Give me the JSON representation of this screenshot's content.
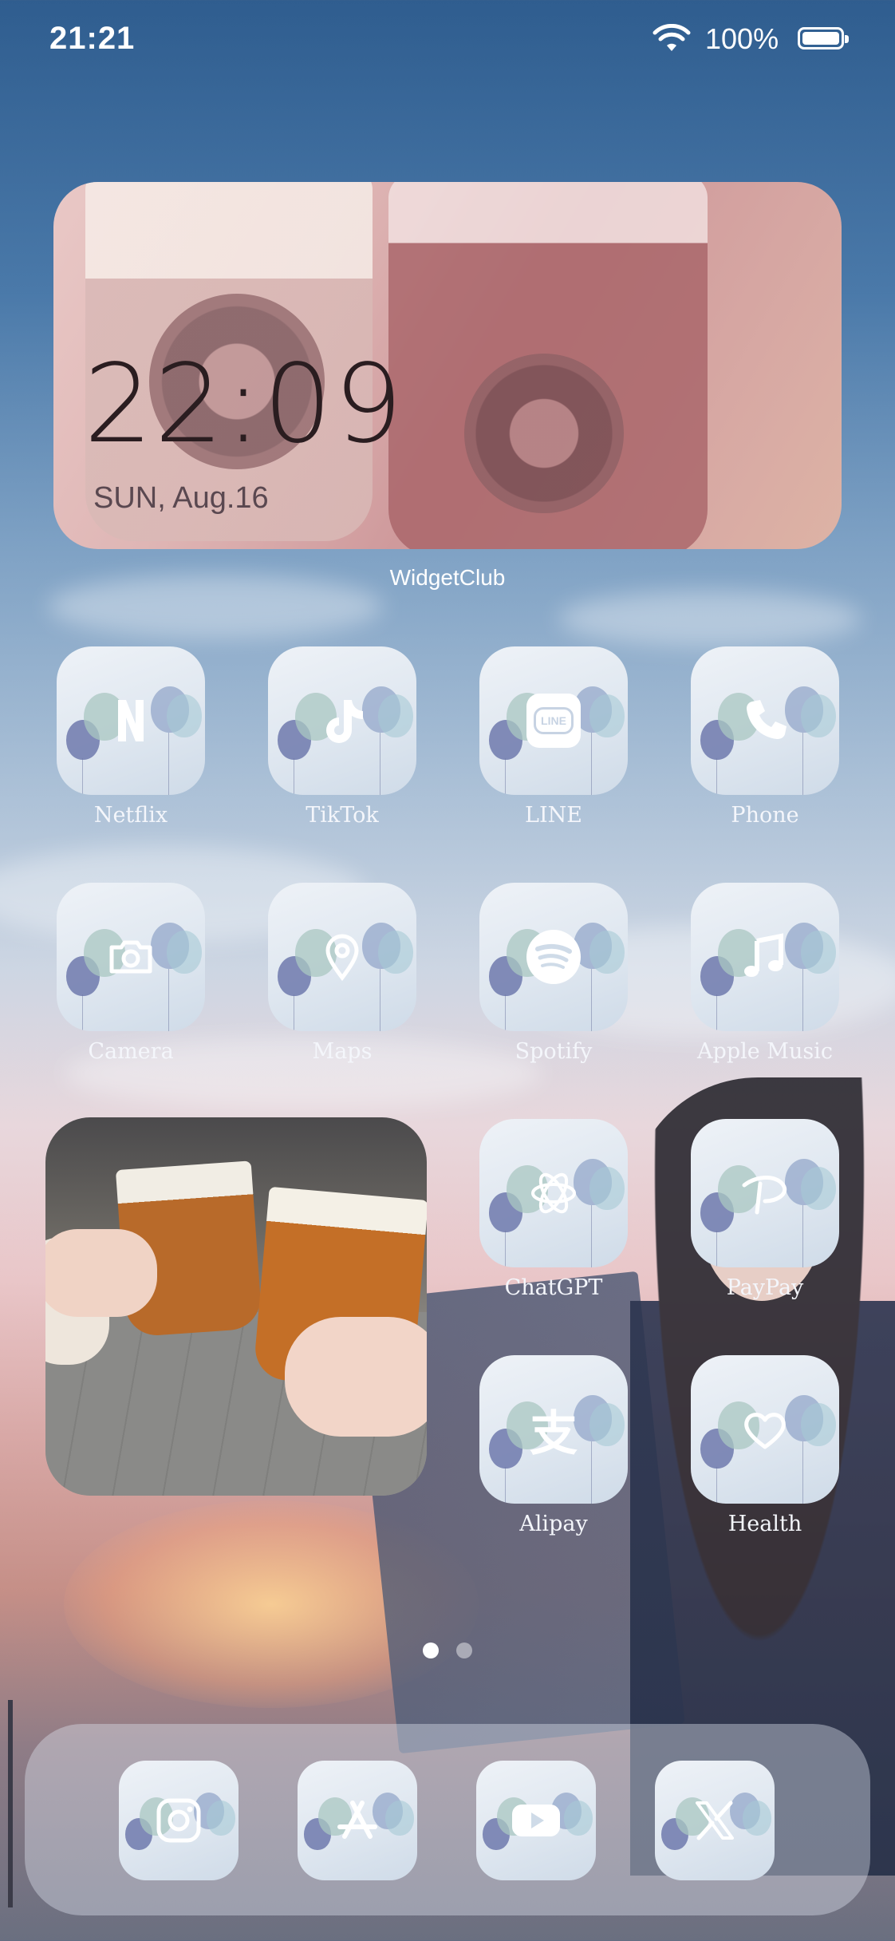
{
  "status_bar": {
    "time": "21:21",
    "battery_percent": "100%"
  },
  "clock_widget": {
    "time": "22:09",
    "date": "SUN, Aug.16",
    "label": "WidgetClub"
  },
  "apps": [
    {
      "label": "Netflix",
      "icon": "netflix-icon"
    },
    {
      "label": "TikTok",
      "icon": "tiktok-icon"
    },
    {
      "label": "LINE",
      "icon": "line-icon",
      "glyph_text": "LINE"
    },
    {
      "label": "Phone",
      "icon": "phone-icon"
    },
    {
      "label": "Camera",
      "icon": "camera-icon"
    },
    {
      "label": "Maps",
      "icon": "map-pin-icon"
    },
    {
      "label": "Spotify",
      "icon": "spotify-icon"
    },
    {
      "label": "Apple Music",
      "icon": "music-note-icon"
    },
    {
      "label": "ChatGPT",
      "icon": "chatgpt-icon"
    },
    {
      "label": "PayPay",
      "icon": "paypay-icon"
    },
    {
      "label": "Alipay",
      "icon": "alipay-icon",
      "glyph_text": "支"
    },
    {
      "label": "Health",
      "icon": "heart-icon"
    }
  ],
  "dock": [
    {
      "icon": "instagram-icon"
    },
    {
      "icon": "app-store-icon"
    },
    {
      "icon": "youtube-icon"
    },
    {
      "icon": "x-icon"
    }
  ],
  "page_indicator": {
    "current": 1,
    "total": 2
  },
  "colors": {
    "icon_glyph": "#ffffff",
    "label_text": "#f4f6fb"
  }
}
